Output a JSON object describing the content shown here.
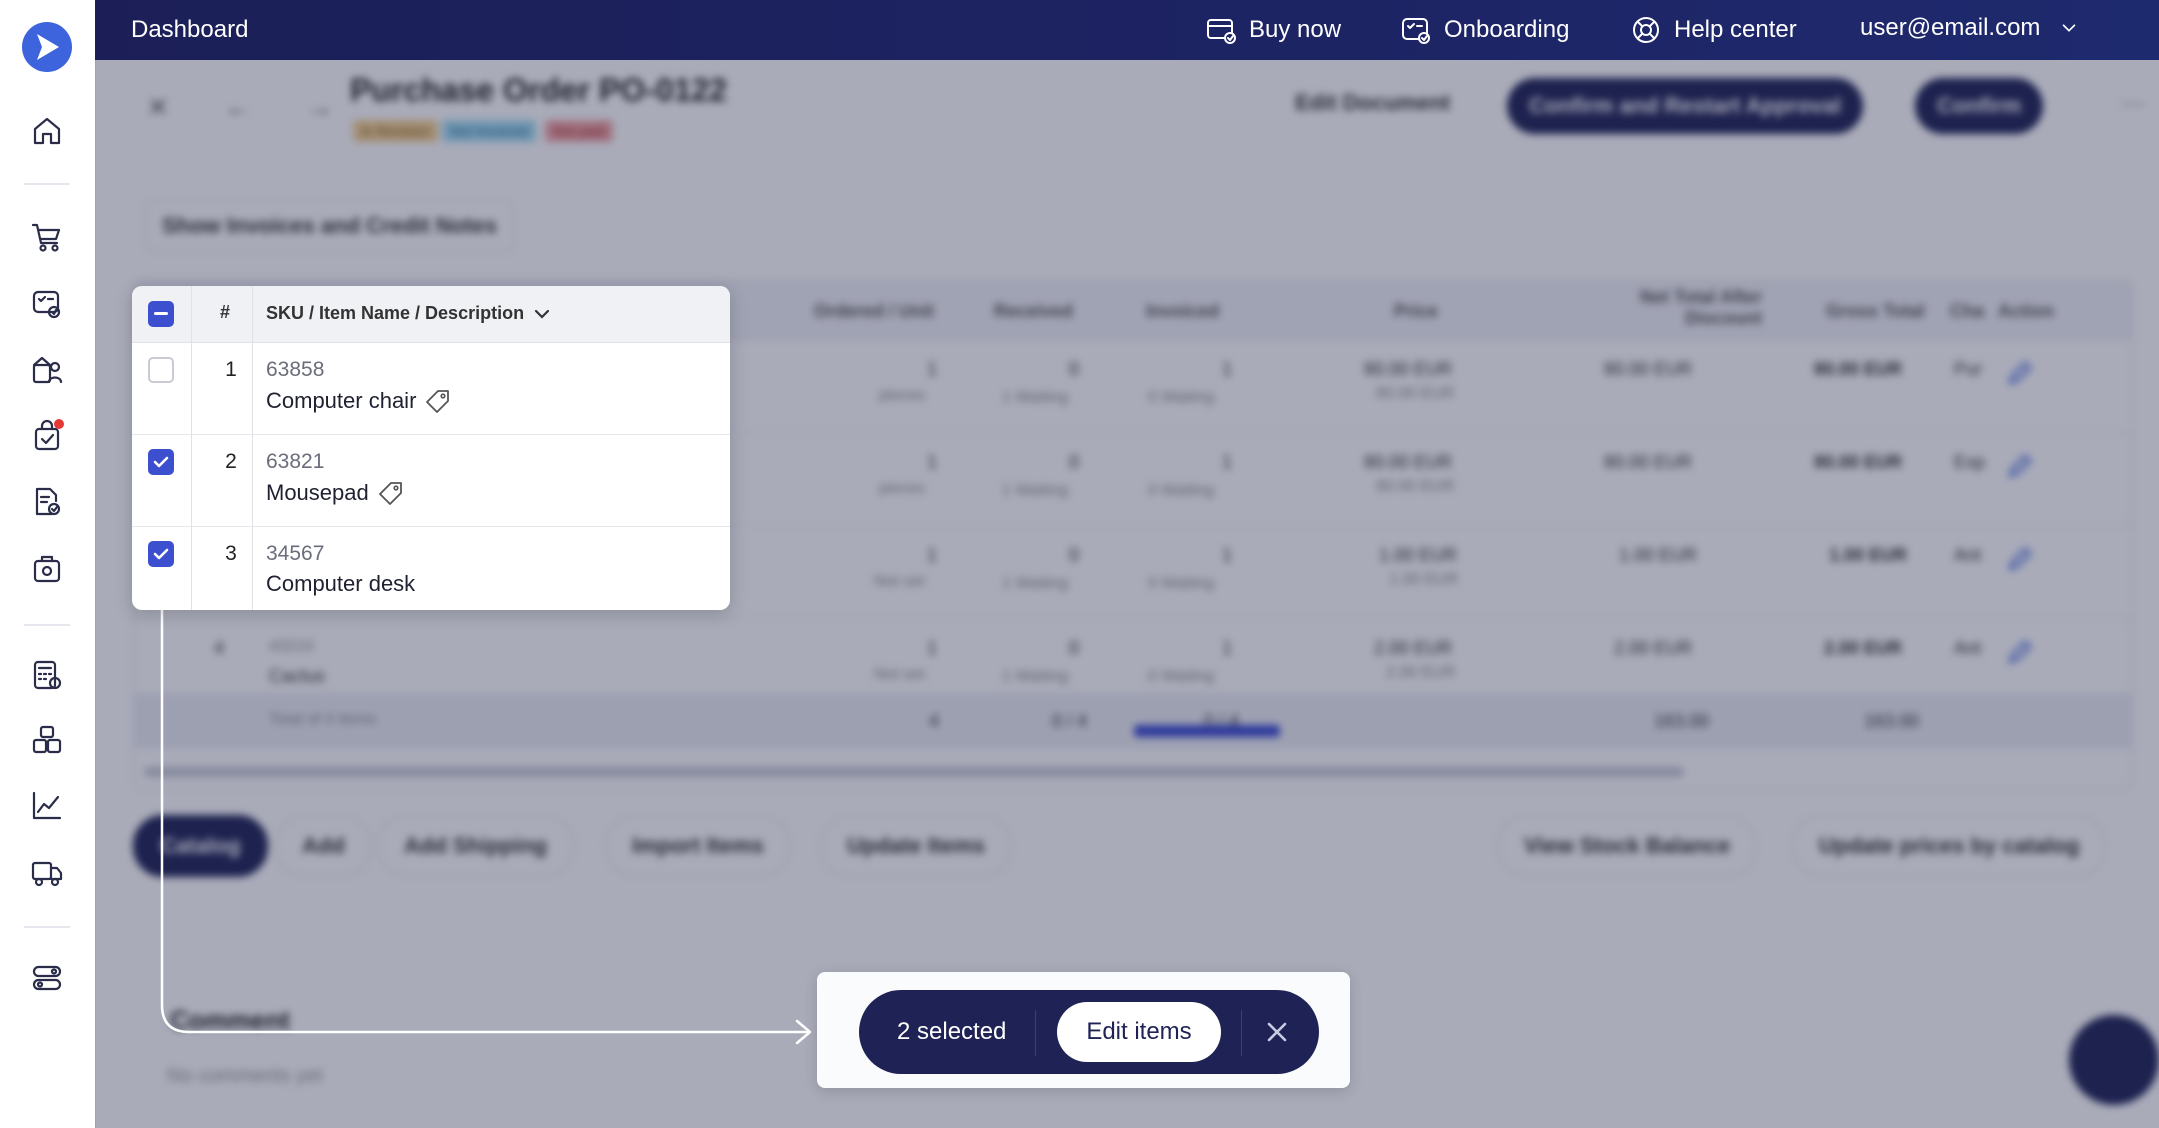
{
  "topbar": {
    "title": "Dashboard",
    "buy_now": "Buy now",
    "onboarding": "Onboarding",
    "help_center": "Help center",
    "user": "user@email.com"
  },
  "document": {
    "title": "Purchase Order PO-0122",
    "badges": [
      "In Revision",
      "Not Invoiced",
      "Not paid"
    ],
    "edit_document": "Edit Document",
    "confirm_restart": "Confirm and Restart Approval",
    "confirm": "Confirm",
    "show_invoices": "Show Invoices and Credit Notes"
  },
  "background_table": {
    "headers": [
      "Ordered / Unit",
      "Received",
      "Invoiced",
      "Price",
      "Net Total After Discount",
      "Gross Total",
      "Cha",
      "Action"
    ],
    "rows": [
      {
        "num": "1",
        "ordered": "1",
        "unit": "pieces",
        "received": "0",
        "received_sub": "1 Waiting",
        "invoiced": "1",
        "invoiced_sub": "0 Waiting",
        "price": "80.00 EUR",
        "price_sub": "80.00 EUR",
        "net": "80.00 EUR",
        "gross": "80.00 EUR",
        "cha": "Pur"
      },
      {
        "num": "2",
        "ordered": "1",
        "unit": "pieces",
        "received": "0",
        "received_sub": "1 Waiting",
        "invoiced": "1",
        "invoiced_sub": "0 Waiting",
        "price": "80.00 EUR",
        "price_sub": "80.00 EUR",
        "net": "80.00 EUR",
        "gross": "80.00 EUR",
        "cha": "Exp"
      },
      {
        "num": "3",
        "ordered": "1",
        "unit": "Not set",
        "received": "0",
        "received_sub": "1 Waiting",
        "invoiced": "1",
        "invoiced_sub": "0 Waiting",
        "price": "1.00 EUR",
        "price_sub": "1.00 EUR",
        "net": "1.00 EUR",
        "gross": "1.00 EUR",
        "cha": "Ant"
      },
      {
        "num": "4",
        "sku": "43210",
        "name": "Cactus",
        "ordered": "1",
        "unit": "Not set",
        "received": "0",
        "received_sub": "1 Waiting",
        "invoiced": "1",
        "invoiced_sub": "0 Waiting",
        "price": "2.00 EUR",
        "price_sub": "2.00 EUR",
        "net": "2.00 EUR",
        "gross": "2.00 EUR",
        "cha": "Ant"
      }
    ],
    "total_label": "Total of 4 items",
    "total_ordered": "4",
    "total_received": "0 / 4",
    "total_invoiced": "0 / 4",
    "total_net": "163.00",
    "total_gross": "163.00"
  },
  "actions": {
    "catalog": "Catalog",
    "add": "Add",
    "add_shipping": "Add Shipping",
    "import_items": "Import Items",
    "update_items": "Update Items",
    "view_stock": "View Stock Balance",
    "update_prices": "Update prices by catalog"
  },
  "comment": {
    "title": "Comment",
    "empty": "No comments yet"
  },
  "focus_table": {
    "col_num": "#",
    "col_item": "SKU / Item Name / Description",
    "rows": [
      {
        "num": "1",
        "sku": "63858",
        "name": "Computer chair",
        "checked": false
      },
      {
        "num": "2",
        "sku": "63821",
        "name": "Mousepad",
        "checked": true
      },
      {
        "num": "3",
        "sku": "34567",
        "name": "Computer desk",
        "checked": true
      }
    ]
  },
  "selection_bar": {
    "selected_text": "2 selected",
    "edit_items": "Edit items"
  },
  "colors": {
    "primary_dark": "#1f2254",
    "accent_blue": "#3b4fcf",
    "logo_blue": "#3d63dd"
  }
}
